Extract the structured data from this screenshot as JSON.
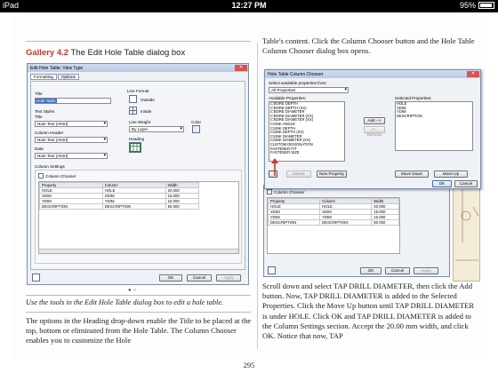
{
  "status": {
    "device": "iPad",
    "time": "12:27 PM",
    "battery": "95%"
  },
  "gallery": {
    "label": "Gallery 4.2",
    "title": "The Edit Hole Table dialog box"
  },
  "left_dialog": {
    "title": "Edit Hole Table: View Type",
    "tabs": [
      "Formatting",
      "Options"
    ],
    "title_label": "Title",
    "title_value": "Hole Table",
    "text_styles_label": "Text Styles",
    "title_style_label": "Title",
    "title_style_value": "Note Text (ANSI)",
    "column_header_label": "Column Header",
    "column_header_value": "Note Text (ANSI)",
    "data_label": "Data",
    "data_value": "Note Text (ANSI)",
    "line_format_label": "Line Format",
    "outside_label": "Outside",
    "inside_label": "Inside",
    "line_weight_label": "Line Weight",
    "line_weight_value": "By Layer",
    "color_label": "Color",
    "heading_label": "Heading",
    "column_settings_label": "Column Settings",
    "column_chooser_label": "Column Chooser",
    "columns": [
      "Property",
      "Column",
      "Width"
    ],
    "rows": [
      [
        "HOLE",
        "HOLE",
        "20.000"
      ],
      [
        "XDIM",
        "XDIM",
        "15.000"
      ],
      [
        "YDIM",
        "YDIM",
        "15.000"
      ],
      [
        "DESCRIPTION",
        "DESCRIPTION",
        "50.000"
      ]
    ],
    "ok": "OK",
    "cancel": "Cancel",
    "apply": "Apply"
  },
  "caption": "Use the tools in the Edit Hole Table dialog box to edit a hole table.",
  "left_text": "The options in the Heading drop-down enable the Title to be placed at the top, bottom or eliminated from the Hole Table. The Column Chooser enables you to customize the Hole",
  "right_text_top": "Table's content. Click the Column Chooser button and the Hole Table Column Chooser dialog box opens.",
  "chooser": {
    "title": "Hole Table Column Chooser",
    "select_from_label": "Select available properties from:",
    "select_from_value": "All Properties",
    "available_label": "Available Properties:",
    "available": [
      "C'BORE DEPTH",
      "C'BORE DEPTH (XX)",
      "C'BORE DIAMETER",
      "C'BORE DIAMETER (XX)",
      "C'BORE DIAMETER (XX)",
      "CSINK ANGLE",
      "CSINK DEPTH",
      "CSINK DEPTH (XX)",
      "CSINK DIAMETER",
      "CSINK DIAMETER (XX)",
      "CUSTOM DESIGNATION",
      "FASTENER FIT",
      "FASTENER SIZE"
    ],
    "selected_label": "Selected Properties:",
    "selected": [
      "HOLE",
      "XDIM",
      "YDIM",
      "DESCRIPTION"
    ],
    "add": "Add -->",
    "remove": "<-- Remove",
    "delete": "Delete",
    "new_property": "New Property",
    "move_down": "Move Down",
    "move_up": "Move Up",
    "ok": "OK",
    "cancel": "Cancel"
  },
  "right_dialog_lower": {
    "column_chooser_label": "Column Chooser",
    "columns": [
      "Property",
      "Column",
      "Width"
    ],
    "rows": [
      [
        "HOLE",
        "HOLE",
        "20.000"
      ],
      [
        "XDIM",
        "XDIM",
        "15.000"
      ],
      [
        "YDIM",
        "YDIM",
        "15.000"
      ],
      [
        "DESCRIPTION",
        "DESCRIPTION",
        "50.000"
      ]
    ],
    "ok": "OK",
    "cancel": "Cancel",
    "apply": "Apply"
  },
  "right_text": "Scroll down and select TAP DRILL DIAMETER, then click the Add button. Now, TAP DRILL DIAMETER is added to the Selected Properties. Click the Move Up button until TAP DRILL DIAMETER is under HOLE. Click OK and TAP DRILL DIAMETER is added to the Column Settings section. Accept the 20.00 mm width, and click OK. Notice that now, TAP",
  "page_number": "295"
}
